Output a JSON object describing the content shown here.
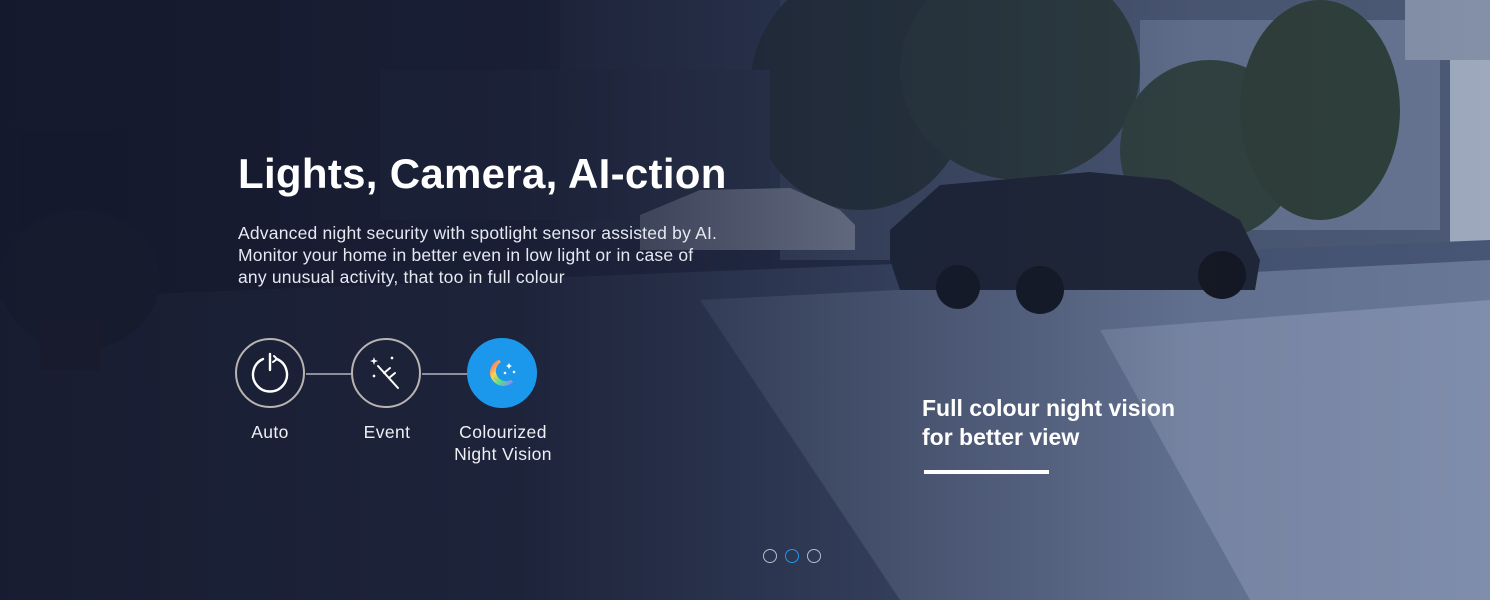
{
  "hero": {
    "title": "Lights, Camera, AI-ction",
    "description_lines": [
      "Advanced night security with spotlight sensor assisted by AI.",
      "Monitor your home in better even in low light or in case of",
      "any unusual activity, that too in full colour"
    ]
  },
  "modes": [
    {
      "label_lines": [
        "Auto"
      ],
      "icon": "power-icon",
      "active": false
    },
    {
      "label_lines": [
        "Event"
      ],
      "icon": "magic-wand-icon",
      "active": false
    },
    {
      "label_lines": [
        "Colourized",
        "Night Vision"
      ],
      "icon": "colour-moon-icon",
      "active": true
    }
  ],
  "caption": {
    "lines": [
      "Full colour night vision",
      "for better view"
    ]
  },
  "carousel": {
    "slide_count": 3,
    "active_index": 1
  },
  "colors": {
    "accent": "#1b98ec",
    "text": "#ffffff",
    "ring": "#b9b4b2"
  }
}
